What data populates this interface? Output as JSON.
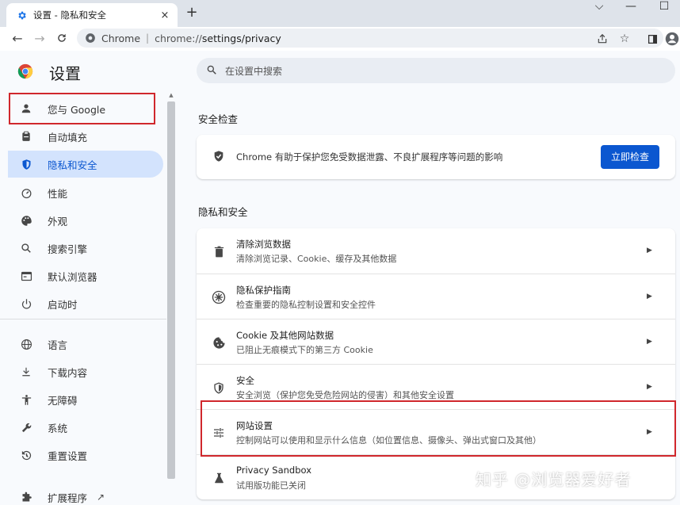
{
  "browser": {
    "tab_title": "设置 - 隐私和安全",
    "tab_close": "×",
    "new_tab": "+",
    "window_controls": [
      "⌵",
      "—",
      "☐"
    ],
    "omnibox_chip": "Chrome",
    "url_prefix": "chrome://",
    "url_path": "settings/privacy"
  },
  "header": {
    "title": "设置",
    "search_placeholder": "在设置中搜索"
  },
  "sidebar": {
    "items": [
      {
        "label": "您与 Google",
        "icon": "person-icon"
      },
      {
        "label": "自动填充",
        "icon": "clipboard-icon"
      },
      {
        "label": "隐私和安全",
        "icon": "shield-icon"
      },
      {
        "label": "性能",
        "icon": "speedometer-icon"
      },
      {
        "label": "外观",
        "icon": "palette-icon"
      },
      {
        "label": "搜索引擎",
        "icon": "search-icon"
      },
      {
        "label": "默认浏览器",
        "icon": "browser-icon"
      },
      {
        "label": "启动时",
        "icon": "power-icon"
      },
      {
        "label": "语言",
        "icon": "globe-icon"
      },
      {
        "label": "下载内容",
        "icon": "download-icon"
      },
      {
        "label": "无障碍",
        "icon": "accessibility-icon"
      },
      {
        "label": "系统",
        "icon": "wrench-icon"
      },
      {
        "label": "重置设置",
        "icon": "reset-icon"
      },
      {
        "label": "扩展程序",
        "icon": "puzzle-icon"
      }
    ]
  },
  "safety_check": {
    "section_title": "安全检查",
    "text": "Chrome 有助于保护您免受数据泄露、不良扩展程序等问题的影响",
    "button": "立即检查"
  },
  "privacy": {
    "section_title": "隐私和安全",
    "rows": [
      {
        "title": "清除浏览数据",
        "sub": "清除浏览记录、Cookie、缓存及其他数据",
        "icon": "trash-icon"
      },
      {
        "title": "隐私保护指南",
        "sub": "检查重要的隐私控制设置和安全控件",
        "icon": "privacy-guide-icon"
      },
      {
        "title": "Cookie 及其他网站数据",
        "sub": "已阻止无痕模式下的第三方 Cookie",
        "icon": "cookie-icon"
      },
      {
        "title": "安全",
        "sub": "安全浏览（保护您免受危险网站的侵害）和其他安全设置",
        "icon": "security-shield-icon"
      },
      {
        "title": "网站设置",
        "sub": "控制网站可以使用和显示什么信息（如位置信息、摄像头、弹出式窗口及其他）",
        "icon": "tune-icon"
      },
      {
        "title": "Privacy Sandbox",
        "sub": "试用版功能已关闭",
        "icon": "flask-icon"
      }
    ]
  },
  "watermark": "知乎 @浏览器爱好者",
  "colors": {
    "accent": "#0b57d0",
    "active_bg": "#d3e3fd",
    "highlight_border": "#d0272c"
  }
}
